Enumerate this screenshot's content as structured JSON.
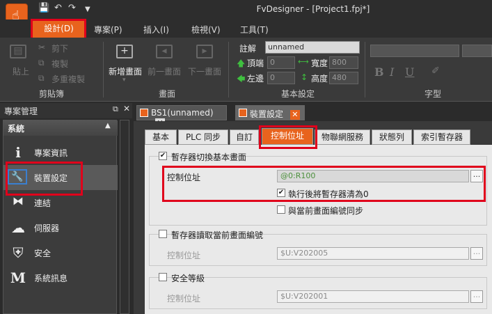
{
  "window": {
    "title": "FvDesigner - [Project1.fpj*]"
  },
  "quick_access": {
    "save_icon": "save-icon",
    "undo_icon": "undo-icon",
    "redo_icon": "redo-icon",
    "more_icon": "chevron-down-icon"
  },
  "menu": {
    "items": [
      {
        "label": "設計(D)",
        "active": true
      },
      {
        "label": "專案(P)"
      },
      {
        "label": "插入(I)"
      },
      {
        "label": "檢視(V)"
      },
      {
        "label": "工具(T)"
      }
    ]
  },
  "ribbon": {
    "clipboard": {
      "paste": "貼上",
      "cut": "剪下",
      "copy": "複製",
      "multi_copy": "多重複製",
      "group": "剪貼簿"
    },
    "screen": {
      "new_screen": "新增畫面",
      "prev_screen": "前一畫面",
      "next_screen": "下一畫面",
      "group": "畫面"
    },
    "basic": {
      "comment_label": "註解",
      "comment_value": "unnamed",
      "top_label": "頂端",
      "top_value": "0",
      "width_label": "寬度",
      "width_value": "800",
      "left_label": "左邊",
      "left_value": "0",
      "height_label": "高度",
      "height_value": "480",
      "group": "基本設定"
    },
    "font": {
      "bold": "B",
      "italic": "I",
      "underline": "U",
      "group": "字型"
    }
  },
  "left_panel": {
    "title": "專案管理",
    "category": "系統",
    "items": [
      {
        "label": "專案資訊",
        "icon": "info-icon"
      },
      {
        "label": "裝置設定",
        "icon": "wrench-icon",
        "selected": true
      },
      {
        "label": "連結",
        "icon": "link-icon"
      },
      {
        "label": "伺服器",
        "icon": "cloud-server-icon"
      },
      {
        "label": "安全",
        "icon": "shield-icon"
      },
      {
        "label": "系統訊息",
        "icon": "message-icon"
      }
    ]
  },
  "doc_tabs": [
    {
      "label": "BS1(unnamed)"
    },
    {
      "label": "裝置設定",
      "active": true
    }
  ],
  "sub_tabs": [
    {
      "label": "基本"
    },
    {
      "label": "PLC 同步"
    },
    {
      "label": "自訂"
    },
    {
      "label": "控制位址",
      "active": true
    },
    {
      "label": "物聯網服務"
    },
    {
      "label": "狀態列"
    },
    {
      "label": "索引暫存器"
    }
  ],
  "section1": {
    "title": "暫存器切換基本畫面",
    "checked": true,
    "address_label": "控制位址",
    "address_value": "@0:R100",
    "clear_label": "執行後將暫存器清為0",
    "clear_checked": true,
    "sync_label": "與當前畫面編號同步",
    "sync_checked": false
  },
  "section2": {
    "title": "暫存器讀取當前畫面編號",
    "checked": false,
    "address_label": "控制位址",
    "address_value": "$U:V202005"
  },
  "section3": {
    "title": "安全等級",
    "checked": false,
    "address_label": "控制位址",
    "address_value": "$U:V202001"
  },
  "browse_label": "..."
}
